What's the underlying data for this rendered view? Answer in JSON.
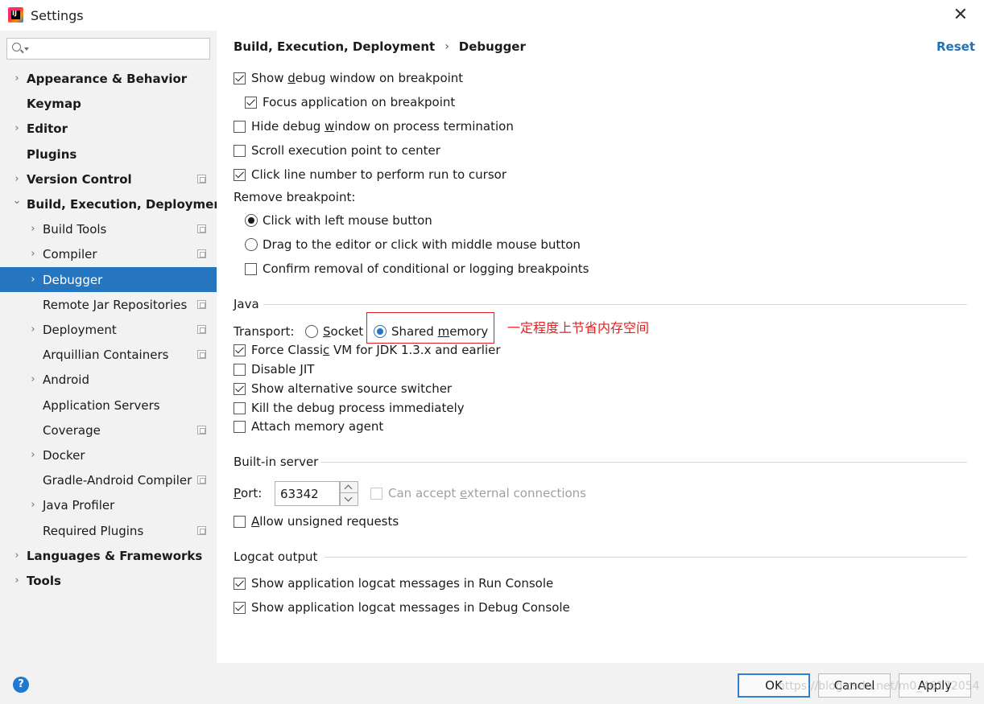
{
  "window": {
    "title": "Settings",
    "app_icon_letters": "IJ"
  },
  "sidebar": {
    "search_placeholder": "",
    "items": [
      {
        "label": "Appearance & Behavior",
        "expandable": true,
        "expanded": false,
        "bold": true,
        "level": 0,
        "project_icon": false
      },
      {
        "label": "Keymap",
        "expandable": false,
        "bold": true,
        "level": 0,
        "project_icon": false
      },
      {
        "label": "Editor",
        "expandable": true,
        "expanded": false,
        "bold": true,
        "level": 0,
        "project_icon": false
      },
      {
        "label": "Plugins",
        "expandable": false,
        "bold": true,
        "level": 0,
        "project_icon": false
      },
      {
        "label": "Version Control",
        "expandable": true,
        "expanded": false,
        "bold": true,
        "level": 0,
        "project_icon": true
      },
      {
        "label": "Build, Execution, Deployment",
        "expandable": true,
        "expanded": true,
        "bold": true,
        "level": 0,
        "project_icon": false
      },
      {
        "label": "Build Tools",
        "expandable": true,
        "expanded": false,
        "bold": false,
        "level": 1,
        "project_icon": true
      },
      {
        "label": "Compiler",
        "expandable": true,
        "expanded": false,
        "bold": false,
        "level": 1,
        "project_icon": true
      },
      {
        "label": "Debugger",
        "expandable": true,
        "expanded": false,
        "bold": false,
        "level": 1,
        "project_icon": false,
        "selected": true
      },
      {
        "label": "Remote Jar Repositories",
        "expandable": false,
        "bold": false,
        "level": 1,
        "project_icon": true
      },
      {
        "label": "Deployment",
        "expandable": true,
        "expanded": false,
        "bold": false,
        "level": 1,
        "project_icon": true
      },
      {
        "label": "Arquillian Containers",
        "expandable": false,
        "bold": false,
        "level": 1,
        "project_icon": true
      },
      {
        "label": "Android",
        "expandable": true,
        "expanded": false,
        "bold": false,
        "level": 1,
        "project_icon": false
      },
      {
        "label": "Application Servers",
        "expandable": false,
        "bold": false,
        "level": 1,
        "project_icon": false
      },
      {
        "label": "Coverage",
        "expandable": false,
        "bold": false,
        "level": 1,
        "project_icon": true
      },
      {
        "label": "Docker",
        "expandable": true,
        "expanded": false,
        "bold": false,
        "level": 1,
        "project_icon": false
      },
      {
        "label": "Gradle-Android Compiler",
        "expandable": false,
        "bold": false,
        "level": 1,
        "project_icon": true
      },
      {
        "label": "Java Profiler",
        "expandable": true,
        "expanded": false,
        "bold": false,
        "level": 1,
        "project_icon": false
      },
      {
        "label": "Required Plugins",
        "expandable": false,
        "bold": false,
        "level": 1,
        "project_icon": true
      },
      {
        "label": "Languages & Frameworks",
        "expandable": true,
        "expanded": false,
        "bold": true,
        "level": 0,
        "project_icon": false
      },
      {
        "label": "Tools",
        "expandable": true,
        "expanded": false,
        "bold": true,
        "level": 0,
        "project_icon": false
      }
    ]
  },
  "header": {
    "breadcrumb_parent": "Build, Execution, Deployment",
    "breadcrumb_separator": "›",
    "breadcrumb_current": "Debugger",
    "reset_label": "Reset"
  },
  "options": {
    "show_debug_window": {
      "pre": "Show ",
      "mn": "d",
      "post": "ebug window on breakpoint",
      "checked": true
    },
    "focus_application": {
      "label": "Focus application on breakpoint",
      "checked": true
    },
    "hide_debug_window": {
      "pre": "Hide debug ",
      "mn": "w",
      "post": "indow on process termination",
      "checked": false
    },
    "scroll_execution": {
      "label": "Scroll execution point to center",
      "checked": false
    },
    "click_line_number": {
      "label": "Click line number to perform run to cursor",
      "checked": true
    },
    "remove_breakpoint_label": "Remove breakpoint:",
    "remove_click_left": {
      "label": "Click with left mouse button",
      "checked": true
    },
    "remove_drag": {
      "label": "Drag to the editor or click with middle mouse button",
      "checked": false
    },
    "confirm_removal": {
      "label": "Confirm removal of conditional or logging breakpoints",
      "checked": false
    }
  },
  "java": {
    "section_title": "Java",
    "transport_label": "Transport:",
    "socket": {
      "mn": "S",
      "post": "ocket",
      "checked": false
    },
    "shared_memory": {
      "pre": "Shared ",
      "mn": "m",
      "post": "emory",
      "checked": true
    },
    "annotation": "一定程度上节省内存空间",
    "annotation_color": "#e02020",
    "force_classic": {
      "pre": "Force Classi",
      "mn": "c",
      "post": " VM for JDK 1.3.x and earlier",
      "checked": true
    },
    "disable_jit": {
      "label": "Disable JIT",
      "checked": false
    },
    "alt_source": {
      "label": "Show alternative source switcher",
      "checked": true
    },
    "kill_debug": {
      "label": "Kill the debug process immediately",
      "checked": false
    },
    "attach_memory": {
      "label": "Attach memory agent",
      "checked": false
    }
  },
  "builtin_server": {
    "section_title": "Built-in server",
    "port_mn": "P",
    "port_label_rest": "ort:",
    "port_value": "63342",
    "external_pre": "Can accept ",
    "external_mn": "e",
    "external_post": "xternal connections",
    "external_checked": false,
    "external_disabled": true,
    "unsigned_mn": "A",
    "unsigned_post": "llow unsigned requests",
    "unsigned_checked": false
  },
  "logcat": {
    "section_title": "Logcat output",
    "run_console": {
      "label": "Show application logcat messages in Run Console",
      "checked": true
    },
    "debug_console": {
      "label": "Show application logcat messages in Debug Console",
      "checked": true
    }
  },
  "footer": {
    "help_label": "?",
    "ok_label": "OK",
    "cancel_label": "Cancel",
    "apply_label": "Apply",
    "watermark": "https://blog.csdn.net/m0_46172054"
  },
  "colors": {
    "selection": "#2675bf",
    "link": "#2470b3",
    "sidebar_bg": "#f2f2f2"
  }
}
